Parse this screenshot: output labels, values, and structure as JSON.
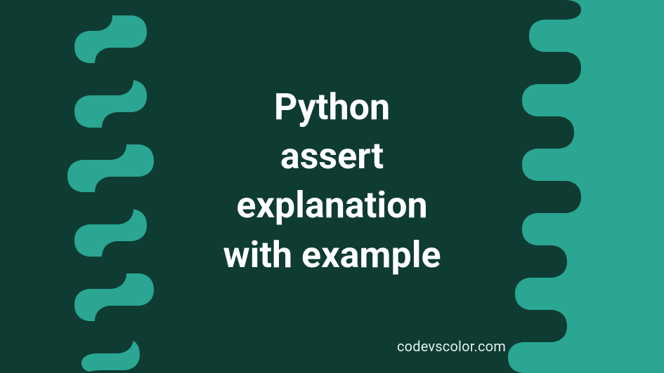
{
  "title_lines": "Python\nassert\nexplanation\nwith example",
  "watermark": "codevscolor.com",
  "colors": {
    "background": "#2AA693",
    "blob": "#0E3B32",
    "title_text": "#FFFFFF",
    "watermark_text": "#E2EFEC"
  }
}
